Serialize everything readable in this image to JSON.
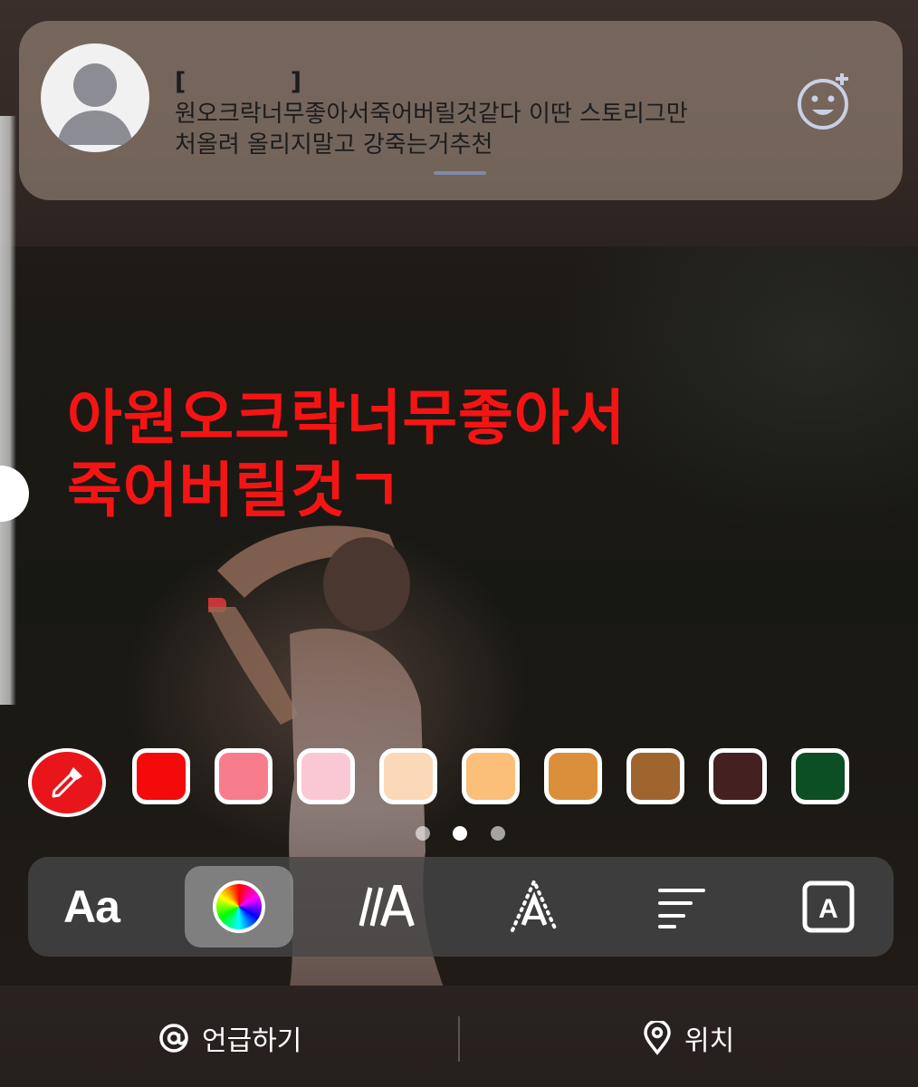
{
  "notification": {
    "title": "[           ]",
    "body_line1": "원오크락너무좋아서죽어버릴것같다 이딴 스토리그만",
    "body_line2": "처올려 올리지말고 강죽는거추천",
    "avatar_icon": "default-profile-icon",
    "reaction_icon": "add-emoji-icon"
  },
  "story": {
    "caption_line1": "아원오크락너무좋아서",
    "caption_line2": "죽어버릴것ㄱ",
    "caption_color": "#f51414"
  },
  "palette": {
    "eyedropper_icon": "eyedropper-icon",
    "colors": [
      "#f40a0a",
      "#f77d8c",
      "#fac8d2",
      "#fad8b8",
      "#fbbf7a",
      "#db8f3b",
      "#a0642e",
      "#442020",
      "#0c4f24"
    ],
    "pages": 3,
    "active_page": 2
  },
  "toolbar": {
    "font_label": "Aa",
    "tools": [
      "font-style-icon",
      "color-wheel-icon",
      "text-animation-icon",
      "text-effect-icon",
      "text-align-icon",
      "text-background-icon"
    ],
    "selected_tool": "color-wheel-icon",
    "background_label": "A"
  },
  "bottom": {
    "mention_label": "언급하기",
    "location_label": "위치"
  }
}
